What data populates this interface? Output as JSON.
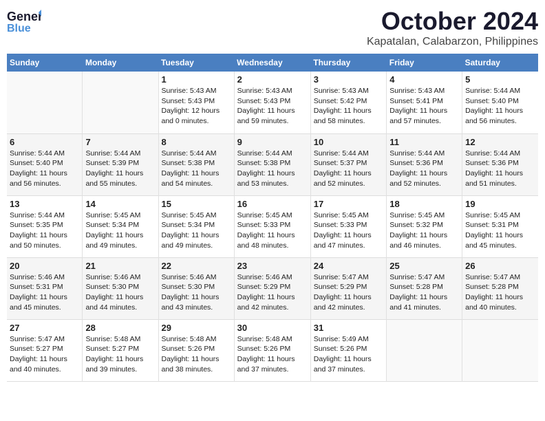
{
  "header": {
    "logo_general": "General",
    "logo_blue": "Blue",
    "month": "October 2024",
    "location": "Kapatalan, Calabarzon, Philippines"
  },
  "days_of_week": [
    "Sunday",
    "Monday",
    "Tuesday",
    "Wednesday",
    "Thursday",
    "Friday",
    "Saturday"
  ],
  "weeks": [
    [
      {
        "day": "",
        "info": ""
      },
      {
        "day": "",
        "info": ""
      },
      {
        "day": "1",
        "info": "Sunrise: 5:43 AM\nSunset: 5:43 PM\nDaylight: 12 hours\nand 0 minutes."
      },
      {
        "day": "2",
        "info": "Sunrise: 5:43 AM\nSunset: 5:43 PM\nDaylight: 11 hours\nand 59 minutes."
      },
      {
        "day": "3",
        "info": "Sunrise: 5:43 AM\nSunset: 5:42 PM\nDaylight: 11 hours\nand 58 minutes."
      },
      {
        "day": "4",
        "info": "Sunrise: 5:43 AM\nSunset: 5:41 PM\nDaylight: 11 hours\nand 57 minutes."
      },
      {
        "day": "5",
        "info": "Sunrise: 5:44 AM\nSunset: 5:40 PM\nDaylight: 11 hours\nand 56 minutes."
      }
    ],
    [
      {
        "day": "6",
        "info": "Sunrise: 5:44 AM\nSunset: 5:40 PM\nDaylight: 11 hours\nand 56 minutes."
      },
      {
        "day": "7",
        "info": "Sunrise: 5:44 AM\nSunset: 5:39 PM\nDaylight: 11 hours\nand 55 minutes."
      },
      {
        "day": "8",
        "info": "Sunrise: 5:44 AM\nSunset: 5:38 PM\nDaylight: 11 hours\nand 54 minutes."
      },
      {
        "day": "9",
        "info": "Sunrise: 5:44 AM\nSunset: 5:38 PM\nDaylight: 11 hours\nand 53 minutes."
      },
      {
        "day": "10",
        "info": "Sunrise: 5:44 AM\nSunset: 5:37 PM\nDaylight: 11 hours\nand 52 minutes."
      },
      {
        "day": "11",
        "info": "Sunrise: 5:44 AM\nSunset: 5:36 PM\nDaylight: 11 hours\nand 52 minutes."
      },
      {
        "day": "12",
        "info": "Sunrise: 5:44 AM\nSunset: 5:36 PM\nDaylight: 11 hours\nand 51 minutes."
      }
    ],
    [
      {
        "day": "13",
        "info": "Sunrise: 5:44 AM\nSunset: 5:35 PM\nDaylight: 11 hours\nand 50 minutes."
      },
      {
        "day": "14",
        "info": "Sunrise: 5:45 AM\nSunset: 5:34 PM\nDaylight: 11 hours\nand 49 minutes."
      },
      {
        "day": "15",
        "info": "Sunrise: 5:45 AM\nSunset: 5:34 PM\nDaylight: 11 hours\nand 49 minutes."
      },
      {
        "day": "16",
        "info": "Sunrise: 5:45 AM\nSunset: 5:33 PM\nDaylight: 11 hours\nand 48 minutes."
      },
      {
        "day": "17",
        "info": "Sunrise: 5:45 AM\nSunset: 5:33 PM\nDaylight: 11 hours\nand 47 minutes."
      },
      {
        "day": "18",
        "info": "Sunrise: 5:45 AM\nSunset: 5:32 PM\nDaylight: 11 hours\nand 46 minutes."
      },
      {
        "day": "19",
        "info": "Sunrise: 5:45 AM\nSunset: 5:31 PM\nDaylight: 11 hours\nand 45 minutes."
      }
    ],
    [
      {
        "day": "20",
        "info": "Sunrise: 5:46 AM\nSunset: 5:31 PM\nDaylight: 11 hours\nand 45 minutes."
      },
      {
        "day": "21",
        "info": "Sunrise: 5:46 AM\nSunset: 5:30 PM\nDaylight: 11 hours\nand 44 minutes."
      },
      {
        "day": "22",
        "info": "Sunrise: 5:46 AM\nSunset: 5:30 PM\nDaylight: 11 hours\nand 43 minutes."
      },
      {
        "day": "23",
        "info": "Sunrise: 5:46 AM\nSunset: 5:29 PM\nDaylight: 11 hours\nand 42 minutes."
      },
      {
        "day": "24",
        "info": "Sunrise: 5:47 AM\nSunset: 5:29 PM\nDaylight: 11 hours\nand 42 minutes."
      },
      {
        "day": "25",
        "info": "Sunrise: 5:47 AM\nSunset: 5:28 PM\nDaylight: 11 hours\nand 41 minutes."
      },
      {
        "day": "26",
        "info": "Sunrise: 5:47 AM\nSunset: 5:28 PM\nDaylight: 11 hours\nand 40 minutes."
      }
    ],
    [
      {
        "day": "27",
        "info": "Sunrise: 5:47 AM\nSunset: 5:27 PM\nDaylight: 11 hours\nand 40 minutes."
      },
      {
        "day": "28",
        "info": "Sunrise: 5:48 AM\nSunset: 5:27 PM\nDaylight: 11 hours\nand 39 minutes."
      },
      {
        "day": "29",
        "info": "Sunrise: 5:48 AM\nSunset: 5:26 PM\nDaylight: 11 hours\nand 38 minutes."
      },
      {
        "day": "30",
        "info": "Sunrise: 5:48 AM\nSunset: 5:26 PM\nDaylight: 11 hours\nand 37 minutes."
      },
      {
        "day": "31",
        "info": "Sunrise: 5:49 AM\nSunset: 5:26 PM\nDaylight: 11 hours\nand 37 minutes."
      },
      {
        "day": "",
        "info": ""
      },
      {
        "day": "",
        "info": ""
      }
    ]
  ]
}
